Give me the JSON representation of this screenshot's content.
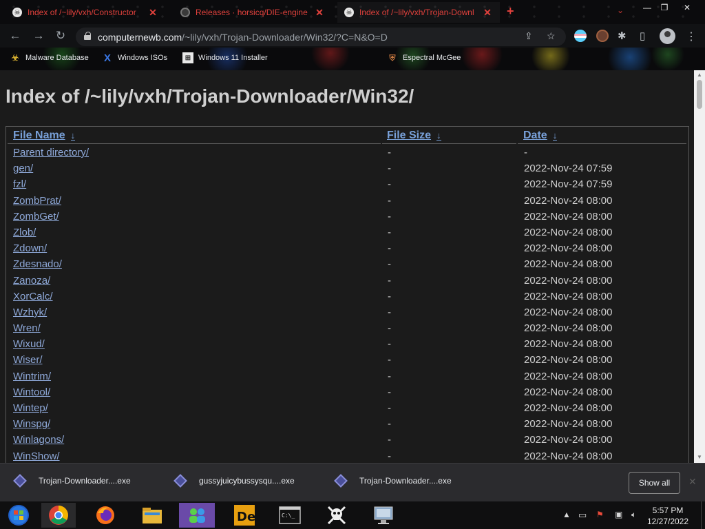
{
  "tabs": [
    {
      "title": "Index of /~lily/vxh/Constructor",
      "favicon": "skull-favicon",
      "active": false
    },
    {
      "title": "Releases · horsicq/DIE-engine",
      "favicon": "github-favicon",
      "active": false
    },
    {
      "title": "Index of /~lily/vxh/Trojan-Downl",
      "favicon": "skull-favicon",
      "active": true
    }
  ],
  "toolbar": {
    "url_host": "computernewb.com",
    "url_path": "/~lily/vxh/Trojan-Downloader/Win32/?C=N&O=D"
  },
  "bookmarks": [
    {
      "label": "Malware Database",
      "icon": "biohazard-icon"
    },
    {
      "label": "Windows ISOs",
      "icon": "x-logo-icon"
    },
    {
      "label": "Windows 11 Installer",
      "icon": "windows-icon"
    },
    {
      "label": "Espectral McGee",
      "icon": "shield-icon"
    }
  ],
  "page": {
    "title": "Index of /~lily/vxh/Trojan-Downloader/Win32/",
    "columns": {
      "name": "File Name",
      "size": "File Size",
      "date": "Date",
      "sort_glyph": "↓"
    },
    "rows": [
      {
        "name": "Parent directory/",
        "size": "-",
        "date": "-"
      },
      {
        "name": "gen/",
        "size": "-",
        "date": "2022-Nov-24 07:59"
      },
      {
        "name": "fzl/",
        "size": "-",
        "date": "2022-Nov-24 07:59"
      },
      {
        "name": "ZombPrat/",
        "size": "-",
        "date": "2022-Nov-24 08:00"
      },
      {
        "name": "ZombGet/",
        "size": "-",
        "date": "2022-Nov-24 08:00"
      },
      {
        "name": "Zlob/",
        "size": "-",
        "date": "2022-Nov-24 08:00"
      },
      {
        "name": "Zdown/",
        "size": "-",
        "date": "2022-Nov-24 08:00"
      },
      {
        "name": "Zdesnado/",
        "size": "-",
        "date": "2022-Nov-24 08:00"
      },
      {
        "name": "Zanoza/",
        "size": "-",
        "date": "2022-Nov-24 08:00"
      },
      {
        "name": "XorCalc/",
        "size": "-",
        "date": "2022-Nov-24 08:00"
      },
      {
        "name": "Wzhyk/",
        "size": "-",
        "date": "2022-Nov-24 08:00"
      },
      {
        "name": "Wren/",
        "size": "-",
        "date": "2022-Nov-24 08:00"
      },
      {
        "name": "Wixud/",
        "size": "-",
        "date": "2022-Nov-24 08:00"
      },
      {
        "name": "Wiser/",
        "size": "-",
        "date": "2022-Nov-24 08:00"
      },
      {
        "name": "Wintrim/",
        "size": "-",
        "date": "2022-Nov-24 08:00"
      },
      {
        "name": "Wintool/",
        "size": "-",
        "date": "2022-Nov-24 08:00"
      },
      {
        "name": "Wintep/",
        "size": "-",
        "date": "2022-Nov-24 08:00"
      },
      {
        "name": "Winspg/",
        "size": "-",
        "date": "2022-Nov-24 08:00"
      },
      {
        "name": "Winlagons/",
        "size": "-",
        "date": "2022-Nov-24 08:00"
      },
      {
        "name": "WinShow/",
        "size": "-",
        "date": "2022-Nov-24 08:00"
      }
    ]
  },
  "downloads": {
    "items": [
      {
        "label": "Trojan-Downloader....exe"
      },
      {
        "label": "gussyjuicybussysqu....exe"
      },
      {
        "label": "Trojan-Downloader....exe"
      }
    ],
    "show_all_label": "Show all"
  },
  "taskbar": {
    "apps": [
      "windows-start-icon",
      "chrome-icon",
      "firefox-icon",
      "file-explorer-icon",
      "people-app-icon",
      "de-app-icon",
      "command-prompt-icon",
      "pirate-skull-icon",
      "monitor-app-icon"
    ],
    "clock_time": "5:57 PM",
    "clock_date": "12/27/2022"
  },
  "colors": {
    "link": "#8ea8d8",
    "tab_text": "#e0413c",
    "page_background": "#1b1b1b"
  }
}
